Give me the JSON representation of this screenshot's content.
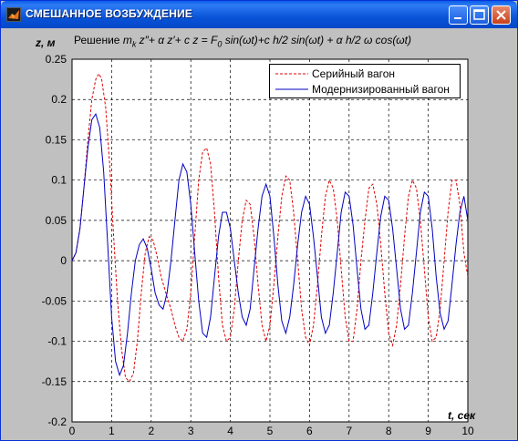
{
  "window": {
    "title": "СМЕШАННОЕ ВОЗБУЖДЕНИЕ",
    "icon": "matlab-figure-icon"
  },
  "plot": {
    "title_prefix": "Решение",
    "title_equation": "m",
    "title_sub": "k",
    "title_rest": " z″+ α z′+ c z = F",
    "title_sub2": "0",
    "title_tail": " sin(ωt)+c h/2 sin(ωt) + α h/2 ω cos(ωt)",
    "ylabel": "z, м",
    "xlabel": "t, сек"
  },
  "chart_data": {
    "type": "line",
    "xlim": [
      0,
      10
    ],
    "ylim": [
      -0.2,
      0.25
    ],
    "xticks": [
      0,
      1,
      2,
      3,
      4,
      5,
      6,
      7,
      8,
      9,
      10
    ],
    "yticks": [
      -0.2,
      -0.15,
      -0.1,
      -0.05,
      0,
      0.05,
      0.1,
      0.15,
      0.2,
      0.25
    ],
    "grid": true,
    "legend_position": "top-right",
    "series": [
      {
        "name": "Серийный вагон",
        "color": "#e00000",
        "style": "dashed",
        "points": [
          [
            0,
            0
          ],
          [
            0.1,
            0.01
          ],
          [
            0.2,
            0.04
          ],
          [
            0.3,
            0.09
          ],
          [
            0.4,
            0.15
          ],
          [
            0.5,
            0.2
          ],
          [
            0.6,
            0.225
          ],
          [
            0.68,
            0.232
          ],
          [
            0.75,
            0.225
          ],
          [
            0.85,
            0.19
          ],
          [
            0.95,
            0.12
          ],
          [
            1.05,
            0.03
          ],
          [
            1.15,
            -0.05
          ],
          [
            1.25,
            -0.11
          ],
          [
            1.35,
            -0.145
          ],
          [
            1.45,
            -0.15
          ],
          [
            1.55,
            -0.14
          ],
          [
            1.65,
            -0.1
          ],
          [
            1.75,
            -0.04
          ],
          [
            1.85,
            0.01
          ],
          [
            1.95,
            0.03
          ],
          [
            2.05,
            0.025
          ],
          [
            2.15,
            0.005
          ],
          [
            2.25,
            -0.02
          ],
          [
            2.4,
            -0.045
          ],
          [
            2.5,
            -0.06
          ],
          [
            2.6,
            -0.08
          ],
          [
            2.7,
            -0.095
          ],
          [
            2.8,
            -0.1
          ],
          [
            2.9,
            -0.085
          ],
          [
            3.0,
            -0.04
          ],
          [
            3.1,
            0.03
          ],
          [
            3.2,
            0.1
          ],
          [
            3.3,
            0.135
          ],
          [
            3.4,
            0.14
          ],
          [
            3.5,
            0.12
          ],
          [
            3.6,
            0.06
          ],
          [
            3.7,
            -0.02
          ],
          [
            3.8,
            -0.08
          ],
          [
            3.9,
            -0.1
          ],
          [
            4.0,
            -0.095
          ],
          [
            4.1,
            -0.06
          ],
          [
            4.2,
            0.0
          ],
          [
            4.3,
            0.05
          ],
          [
            4.4,
            0.075
          ],
          [
            4.5,
            0.07
          ],
          [
            4.6,
            0.03
          ],
          [
            4.7,
            -0.03
          ],
          [
            4.8,
            -0.08
          ],
          [
            4.9,
            -0.1
          ],
          [
            5.0,
            -0.08
          ],
          [
            5.1,
            -0.03
          ],
          [
            5.2,
            0.03
          ],
          [
            5.3,
            0.08
          ],
          [
            5.4,
            0.105
          ],
          [
            5.5,
            0.1
          ],
          [
            5.6,
            0.06
          ],
          [
            5.7,
            0.0
          ],
          [
            5.8,
            -0.06
          ],
          [
            5.9,
            -0.095
          ],
          [
            6.0,
            -0.105
          ],
          [
            6.1,
            -0.08
          ],
          [
            6.2,
            -0.03
          ],
          [
            6.3,
            0.03
          ],
          [
            6.4,
            0.08
          ],
          [
            6.5,
            0.1
          ],
          [
            6.6,
            0.09
          ],
          [
            6.7,
            0.05
          ],
          [
            6.8,
            -0.01
          ],
          [
            6.9,
            -0.07
          ],
          [
            7.0,
            -0.1
          ],
          [
            7.1,
            -0.1
          ],
          [
            7.2,
            -0.06
          ],
          [
            7.3,
            0.0
          ],
          [
            7.4,
            0.05
          ],
          [
            7.5,
            0.09
          ],
          [
            7.6,
            0.095
          ],
          [
            7.7,
            0.07
          ],
          [
            7.8,
            0.02
          ],
          [
            7.9,
            -0.04
          ],
          [
            8.0,
            -0.09
          ],
          [
            8.1,
            -0.105
          ],
          [
            8.2,
            -0.08
          ],
          [
            8.3,
            -0.03
          ],
          [
            8.4,
            0.03
          ],
          [
            8.5,
            0.08
          ],
          [
            8.6,
            0.1
          ],
          [
            8.7,
            0.09
          ],
          [
            8.8,
            0.05
          ],
          [
            8.9,
            -0.01
          ],
          [
            9.0,
            -0.07
          ],
          [
            9.1,
            -0.1
          ],
          [
            9.2,
            -0.095
          ],
          [
            9.3,
            -0.06
          ],
          [
            9.4,
            0.0
          ],
          [
            9.5,
            0.06
          ],
          [
            9.6,
            0.1
          ],
          [
            9.7,
            0.1
          ],
          [
            9.8,
            0.07
          ],
          [
            9.9,
            0.01
          ],
          [
            10.0,
            -0.02
          ]
        ]
      },
      {
        "name": "Модернизированный вагон",
        "color": "#0000c0",
        "style": "solid",
        "points": [
          [
            0,
            0
          ],
          [
            0.1,
            0.01
          ],
          [
            0.2,
            0.04
          ],
          [
            0.3,
            0.09
          ],
          [
            0.4,
            0.14
          ],
          [
            0.5,
            0.175
          ],
          [
            0.6,
            0.182
          ],
          [
            0.7,
            0.165
          ],
          [
            0.8,
            0.11
          ],
          [
            0.9,
            0.02
          ],
          [
            1.0,
            -0.07
          ],
          [
            1.1,
            -0.125
          ],
          [
            1.2,
            -0.142
          ],
          [
            1.3,
            -0.13
          ],
          [
            1.4,
            -0.09
          ],
          [
            1.5,
            -0.04
          ],
          [
            1.6,
            0.0
          ],
          [
            1.7,
            0.02
          ],
          [
            1.8,
            0.027
          ],
          [
            1.9,
            0.015
          ],
          [
            2.0,
            -0.01
          ],
          [
            2.1,
            -0.04
          ],
          [
            2.2,
            -0.055
          ],
          [
            2.3,
            -0.06
          ],
          [
            2.4,
            -0.04
          ],
          [
            2.5,
            0.0
          ],
          [
            2.6,
            0.05
          ],
          [
            2.7,
            0.1
          ],
          [
            2.8,
            0.12
          ],
          [
            2.9,
            0.11
          ],
          [
            3.0,
            0.07
          ],
          [
            3.1,
            0.01
          ],
          [
            3.2,
            -0.05
          ],
          [
            3.3,
            -0.09
          ],
          [
            3.4,
            -0.095
          ],
          [
            3.5,
            -0.07
          ],
          [
            3.6,
            -0.02
          ],
          [
            3.7,
            0.03
          ],
          [
            3.8,
            0.06
          ],
          [
            3.9,
            0.06
          ],
          [
            4.0,
            0.04
          ],
          [
            4.1,
            0.0
          ],
          [
            4.2,
            -0.04
          ],
          [
            4.3,
            -0.07
          ],
          [
            4.4,
            -0.08
          ],
          [
            4.5,
            -0.06
          ],
          [
            4.6,
            -0.01
          ],
          [
            4.7,
            0.04
          ],
          [
            4.8,
            0.08
          ],
          [
            4.9,
            0.095
          ],
          [
            5.0,
            0.08
          ],
          [
            5.1,
            0.03
          ],
          [
            5.2,
            -0.03
          ],
          [
            5.3,
            -0.075
          ],
          [
            5.4,
            -0.09
          ],
          [
            5.5,
            -0.07
          ],
          [
            5.6,
            -0.03
          ],
          [
            5.7,
            0.02
          ],
          [
            5.8,
            0.06
          ],
          [
            5.9,
            0.08
          ],
          [
            6.0,
            0.07
          ],
          [
            6.1,
            0.03
          ],
          [
            6.2,
            -0.02
          ],
          [
            6.3,
            -0.07
          ],
          [
            6.4,
            -0.09
          ],
          [
            6.5,
            -0.08
          ],
          [
            6.6,
            -0.04
          ],
          [
            6.7,
            0.01
          ],
          [
            6.8,
            0.06
          ],
          [
            6.9,
            0.085
          ],
          [
            7.0,
            0.08
          ],
          [
            7.1,
            0.045
          ],
          [
            7.2,
            -0.01
          ],
          [
            7.3,
            -0.06
          ],
          [
            7.4,
            -0.085
          ],
          [
            7.5,
            -0.08
          ],
          [
            7.6,
            -0.04
          ],
          [
            7.7,
            0.01
          ],
          [
            7.8,
            0.055
          ],
          [
            7.9,
            0.08
          ],
          [
            8.0,
            0.075
          ],
          [
            8.1,
            0.04
          ],
          [
            8.2,
            -0.01
          ],
          [
            8.3,
            -0.06
          ],
          [
            8.4,
            -0.085
          ],
          [
            8.5,
            -0.08
          ],
          [
            8.6,
            -0.04
          ],
          [
            8.7,
            0.01
          ],
          [
            8.8,
            0.06
          ],
          [
            8.9,
            0.085
          ],
          [
            9.0,
            0.08
          ],
          [
            9.1,
            0.04
          ],
          [
            9.2,
            -0.02
          ],
          [
            9.3,
            -0.065
          ],
          [
            9.4,
            -0.085
          ],
          [
            9.5,
            -0.075
          ],
          [
            9.6,
            -0.03
          ],
          [
            9.7,
            0.02
          ],
          [
            9.8,
            0.06
          ],
          [
            9.9,
            0.08
          ],
          [
            10.0,
            0.05
          ]
        ]
      }
    ]
  }
}
